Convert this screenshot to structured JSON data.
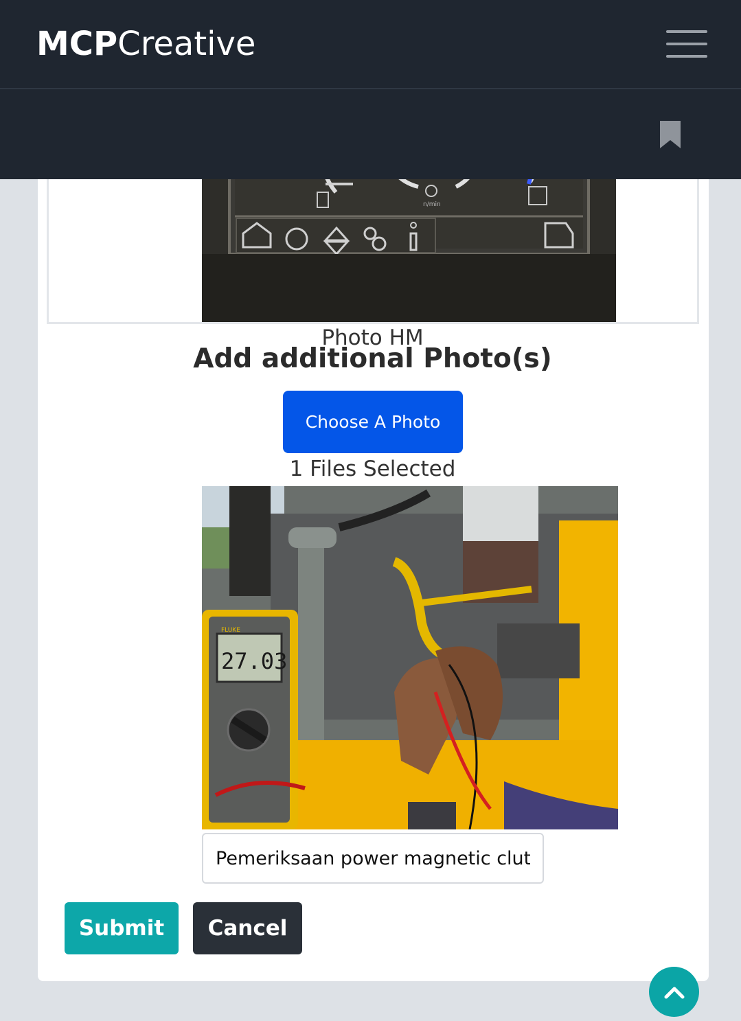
{
  "navbar": {
    "brand_bold": "MCP",
    "brand_light": "Creative",
    "menu_icon": "hamburger-menu-icon"
  },
  "subbar": {
    "bookmark_icon": "bookmark-icon"
  },
  "form": {
    "photo_hm_caption": "Photo HM",
    "add_photos_title": "Add additional Photo(s)",
    "choose_photo_label": "Choose A Photo",
    "files_selected_text": "1 Files Selected",
    "description_value": "Pemeriksaan power magnetic clutch",
    "submit_label": "Submit",
    "cancel_label": "Cancel"
  },
  "multimeter_display": {
    "reading": "27.03",
    "brand": "FLUKE"
  },
  "colors": {
    "navbar": "#1f2630",
    "primary": "#0456e8",
    "teal": "#0da7a9",
    "dark_button": "#2a3038"
  },
  "scroll_top_icon": "chevron-up-icon"
}
